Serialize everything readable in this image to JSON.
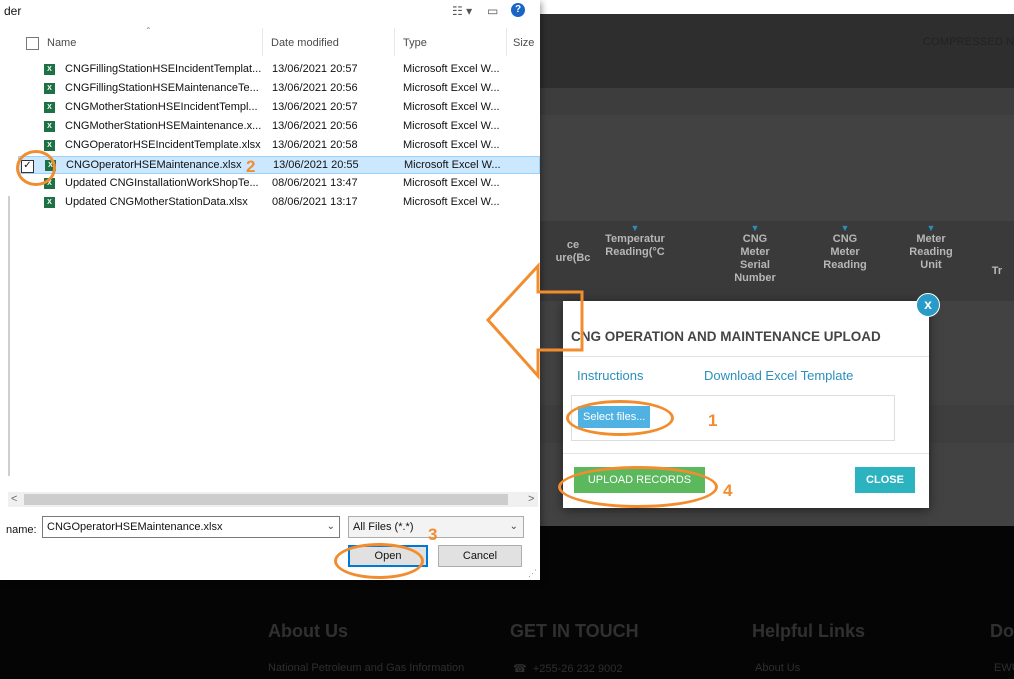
{
  "background": {
    "header_text": "COMPRESSED NA",
    "table_headers": [
      {
        "label": "ce\nure(Bc"
      },
      {
        "label": "Temperatur\nReading(°C"
      },
      {
        "label": "CNG\nMeter\nSerial\nNumber"
      },
      {
        "label": "CNG\nMeter\nReading"
      },
      {
        "label": "Meter\nReading\nUnit"
      },
      {
        "label": "Tr"
      }
    ],
    "footer": {
      "about_title": "About Us",
      "about_text": "National Petroleum and Gas Information",
      "touch_title": "GET IN TOUCH",
      "touch_phone": "+255-26 232 9002",
      "links_title": "Helpful Links",
      "links_item": "About Us",
      "cut_title": "Do",
      "cut_text": "EWU"
    }
  },
  "modal": {
    "close_icon": "x",
    "title": "CNG OPERATION AND MAINTENANCE UPLOAD",
    "instructions_link": "Instructions",
    "download_link": "Download Excel Template",
    "select_files_label": "Select files...",
    "upload_button": "UPLOAD RECORDS",
    "close_button": "CLOSE"
  },
  "file_dialog": {
    "title": "der",
    "columns": {
      "name": "Name",
      "date": "Date modified",
      "type": "Type",
      "size": "Size"
    },
    "files": [
      {
        "name": "CNGFillingStationHSEIncidentTemplat...",
        "date": "13/06/2021 20:57",
        "type": "Microsoft Excel W...",
        "selected": false
      },
      {
        "name": "CNGFillingStationHSEMaintenanceTe...",
        "date": "13/06/2021 20:56",
        "type": "Microsoft Excel W...",
        "selected": false
      },
      {
        "name": "CNGMotherStationHSEIncidentTempl...",
        "date": "13/06/2021 20:57",
        "type": "Microsoft Excel W...",
        "selected": false
      },
      {
        "name": "CNGMotherStationHSEMaintenance.x...",
        "date": "13/06/2021 20:56",
        "type": "Microsoft Excel W...",
        "selected": false
      },
      {
        "name": "CNGOperatorHSEIncidentTemplate.xlsx",
        "date": "13/06/2021 20:58",
        "type": "Microsoft Excel W...",
        "selected": false
      },
      {
        "name": "CNGOperatorHSEMaintenance.xlsx",
        "date": "13/06/2021 20:55",
        "type": "Microsoft Excel W...",
        "selected": true
      },
      {
        "name": "Updated CNGInstallationWorkShopTe...",
        "date": "08/06/2021 13:47",
        "type": "Microsoft Excel W...",
        "selected": false
      },
      {
        "name": "Updated CNGMotherStationData.xlsx",
        "date": "08/06/2021 13:17",
        "type": "Microsoft Excel W...",
        "selected": false
      }
    ],
    "filename_label": "name:",
    "filename_value": "CNGOperatorHSEMaintenance.xlsx",
    "filetype_value": "All Files (*.*)",
    "open_button": "Open",
    "cancel_button": "Cancel"
  },
  "annotations": {
    "step1": "1",
    "step2": "2",
    "step3": "3",
    "step4": "4",
    "color": "#f28d2f"
  },
  "colors": {
    "accent_blue": "#2a8fbd",
    "upload_green": "#5cb85c",
    "close_teal": "#2bb3c0",
    "selected_row": "#cce8ff"
  }
}
